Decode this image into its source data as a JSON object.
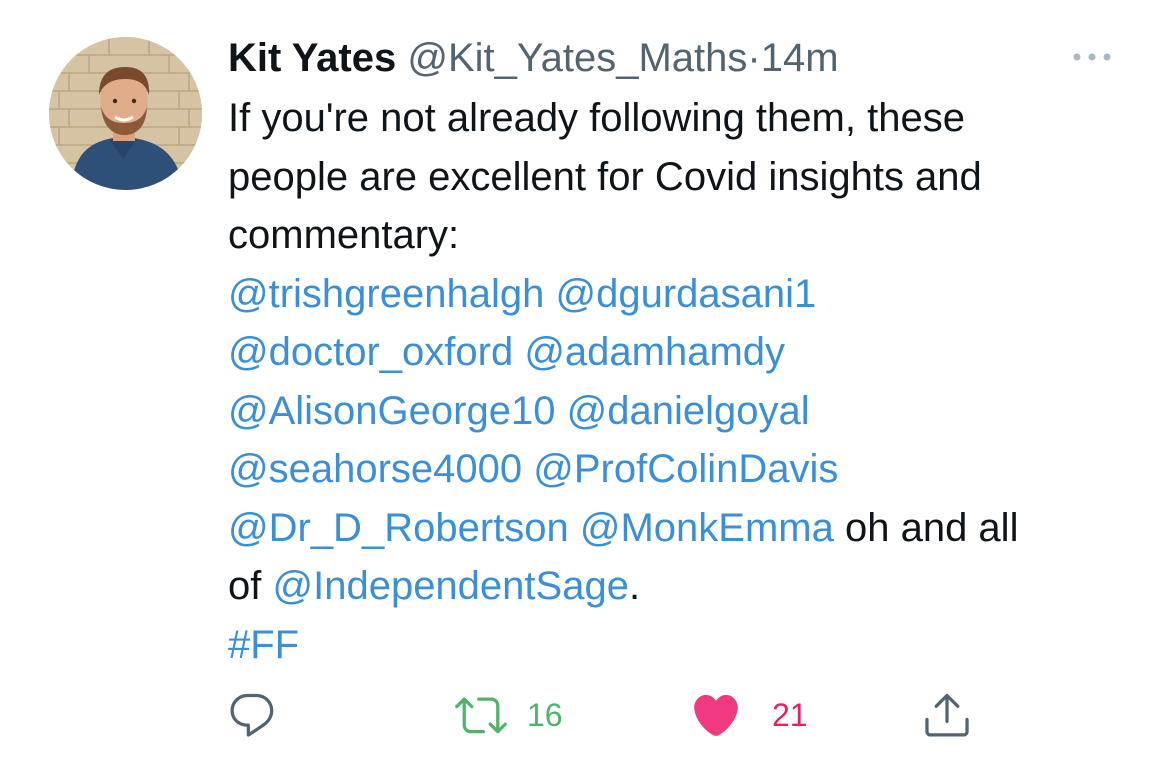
{
  "tweet": {
    "author": {
      "display_name": "Kit Yates",
      "handle": "@Kit_Yates_Maths",
      "separator": "·",
      "time": "14m"
    },
    "more_label": "More",
    "lines": [
      [
        {
          "t": "text",
          "v": "If you're not already following them, these"
        }
      ],
      [
        {
          "t": "text",
          "v": "people are excellent for Covid insights and"
        }
      ],
      [
        {
          "t": "text",
          "v": "commentary:"
        }
      ],
      [
        {
          "t": "mention",
          "v": "@trishgreenhalgh"
        },
        {
          "t": "text",
          "v": " "
        },
        {
          "t": "mention",
          "v": "@dgurdasani1"
        }
      ],
      [
        {
          "t": "mention",
          "v": "@doctor_oxford"
        },
        {
          "t": "text",
          "v": " "
        },
        {
          "t": "mention",
          "v": "@adamhamdy"
        }
      ],
      [
        {
          "t": "mention",
          "v": "@AlisonGeorge10"
        },
        {
          "t": "text",
          "v": " "
        },
        {
          "t": "mention",
          "v": "@danielgoyal"
        }
      ],
      [
        {
          "t": "mention",
          "v": "@seahorse4000"
        },
        {
          "t": "text",
          "v": " "
        },
        {
          "t": "mention",
          "v": "@ProfColinDavis"
        }
      ],
      [
        {
          "t": "mention",
          "v": "@Dr_D_Robertson"
        },
        {
          "t": "text",
          "v": " "
        },
        {
          "t": "mention",
          "v": "@MonkEmma"
        },
        {
          "t": "text",
          "v": " oh and all"
        }
      ],
      [
        {
          "t": "text",
          "v": "of "
        },
        {
          "t": "mention",
          "v": "@IndependentSage"
        },
        {
          "t": "text",
          "v": "."
        }
      ],
      [
        {
          "t": "hashtag",
          "v": "#FF"
        }
      ]
    ],
    "actions": {
      "reply": {
        "icon": "reply-icon",
        "count": ""
      },
      "retweet": {
        "icon": "retweet-icon",
        "count": "16"
      },
      "like": {
        "icon": "heart-icon",
        "count": "21"
      },
      "share": {
        "icon": "share-icon",
        "count": ""
      }
    }
  },
  "colors": {
    "link": "#3b8fd6",
    "secondary_text": "#536471",
    "retweet": "#4fb36b",
    "like": "#e0245e",
    "primary_text": "#0f1419"
  }
}
